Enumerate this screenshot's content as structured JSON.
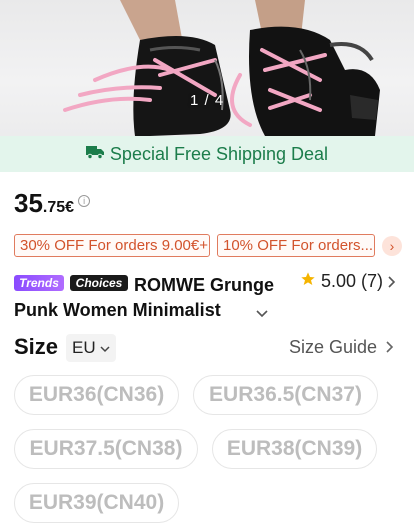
{
  "gallery": {
    "counter": "1 / 4",
    "image_icon": "boots-photo"
  },
  "shipping": {
    "icon": "truck-icon",
    "label": "Special Free Shipping Deal"
  },
  "price": {
    "main": "35",
    "decimal": ".75€",
    "info_icon": "info-icon"
  },
  "coupons": [
    "30% OFF For orders 9.00€+",
    "10% OFF For orders..."
  ],
  "coupon_more_icon": "chevron-right-icon",
  "product": {
    "tags": [
      "Trends",
      "Choices"
    ],
    "title_line1": "ROMWE Grunge",
    "title_line2": "Punk Women Minimalist",
    "rating": "5.00",
    "reviews": "(7)"
  },
  "size": {
    "label": "Size",
    "unit": "EU",
    "guide": "Size Guide",
    "options": [
      "EUR36(CN36)",
      "EUR36.5(CN37)",
      "EUR37.5(CN38)",
      "EUR38(CN39)",
      "EUR39(CN40)"
    ]
  },
  "colors": {
    "accent_green": "#1c7d4b",
    "coupon": "#d2532c",
    "star": "#f5b400"
  }
}
